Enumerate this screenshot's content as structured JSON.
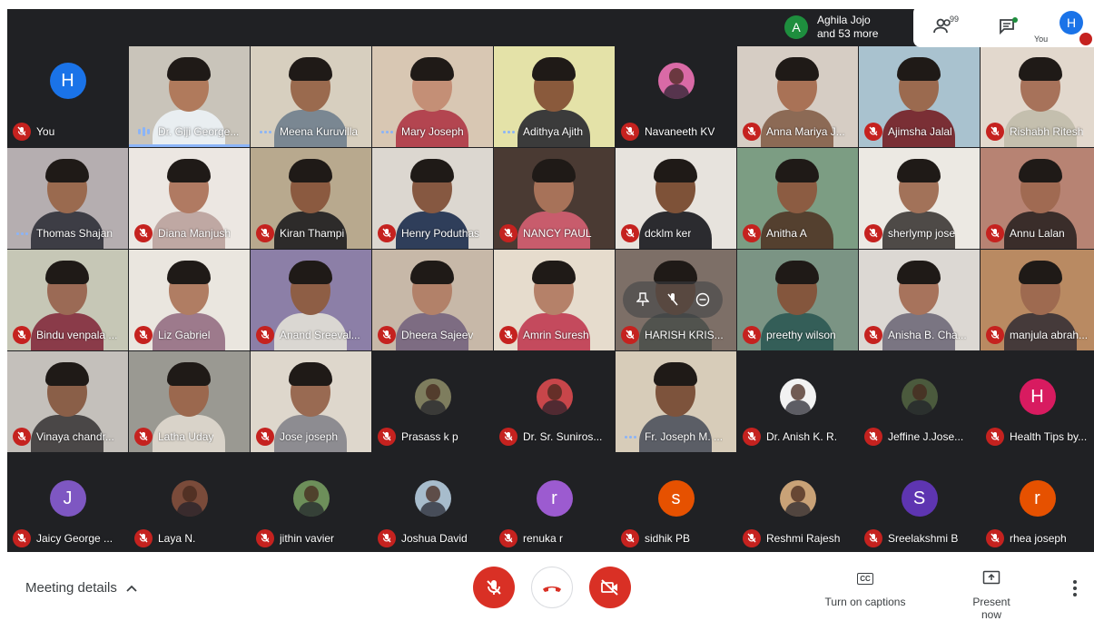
{
  "participants_chip": {
    "initial": "A",
    "line1": "Aghila Jojo",
    "line2": "and 53 more"
  },
  "top_bar": {
    "people_count": "99",
    "self_initial": "H",
    "self_label": "You"
  },
  "tiles": [
    {
      "name": "You",
      "state": "muted",
      "kind": "avatar",
      "initial": "H",
      "color": "#1a73e8"
    },
    {
      "name": "Dr. Giji George...",
      "state": "speaking",
      "kind": "video",
      "bg": "#c9c4ba",
      "skin": "#b07a5c",
      "cloth": "#e9eef1"
    },
    {
      "name": "Meena Kuruvilla",
      "state": "dots",
      "kind": "video",
      "bg": "#d7cfbf",
      "skin": "#9a6a4e",
      "cloth": "#7a8792"
    },
    {
      "name": "Mary Joseph",
      "state": "dots",
      "kind": "video",
      "bg": "#d8c7b3",
      "skin": "#c48f76",
      "cloth": "#b34550"
    },
    {
      "name": "Adithya Ajith",
      "state": "dots",
      "kind": "video",
      "bg": "#e4e2a8",
      "skin": "#8a5a3c",
      "cloth": "#3b3b3b"
    },
    {
      "name": "Navaneeth KV",
      "state": "muted",
      "kind": "avatar-photo",
      "color": "#d96aa6"
    },
    {
      "name": "Anna Mariya J...",
      "state": "muted",
      "kind": "video",
      "bg": "#d6cdc4",
      "skin": "#a97256",
      "cloth": "#8c6a55"
    },
    {
      "name": "Ajimsha Jalal",
      "state": "muted",
      "kind": "video",
      "bg": "#a9c2cf",
      "skin": "#9b6a4f",
      "cloth": "#7a2f35"
    },
    {
      "name": "Rishabh Ritesh",
      "state": "muted",
      "kind": "video",
      "bg": "#e2d8cd",
      "skin": "#a7725a",
      "cloth": "#c4bfae"
    },
    {
      "name": "Thomas Shajan",
      "state": "dots",
      "kind": "video",
      "bg": "#b5aeb0",
      "skin": "#9a6a4f",
      "cloth": "#3d3d45"
    },
    {
      "name": "Diana Manjush",
      "state": "muted",
      "kind": "video",
      "bg": "#ece7e2",
      "skin": "#b07a62",
      "cloth": "#bfa8a3"
    },
    {
      "name": "Kiran Thampi",
      "state": "muted",
      "kind": "video",
      "bg": "#b8a98e",
      "skin": "#8b5a40",
      "cloth": "#2d2b2a"
    },
    {
      "name": "Henry Poduthas",
      "state": "muted",
      "kind": "video",
      "bg": "#dcd7d0",
      "skin": "#865841",
      "cloth": "#2f3e5a"
    },
    {
      "name": "NANCY PAUL",
      "state": "muted",
      "kind": "video",
      "bg": "#4a3a33",
      "skin": "#a77259",
      "cloth": "#c85c6c"
    },
    {
      "name": "dcklm ker",
      "state": "muted",
      "kind": "video",
      "bg": "#e7e3dd",
      "skin": "#7e5238",
      "cloth": "#2b2b2f"
    },
    {
      "name": "Anitha A",
      "state": "muted",
      "kind": "video",
      "bg": "#7c9d83",
      "skin": "#8c5c42",
      "cloth": "#54402f"
    },
    {
      "name": "sherlymp jose",
      "state": "muted",
      "kind": "video",
      "bg": "#ece9e3",
      "skin": "#a27259",
      "cloth": "#4e4a47"
    },
    {
      "name": "Annu Lalan",
      "state": "muted",
      "kind": "video",
      "bg": "#b78373",
      "skin": "#a06a52",
      "cloth": "#3a2d2a"
    },
    {
      "name": "Bindu venpala ...",
      "state": "muted",
      "kind": "video",
      "bg": "#c6c7b6",
      "skin": "#9b6a55",
      "cloth": "#8a3b49"
    },
    {
      "name": "Liz Gabriel",
      "state": "muted",
      "kind": "video",
      "bg": "#eae6df",
      "skin": "#b07d63",
      "cloth": "#9d7a8c"
    },
    {
      "name": "Anand Sreeval...",
      "state": "muted",
      "kind": "video",
      "bg": "#8c7fa7",
      "skin": "#8e5e45",
      "cloth": "#dad7d2"
    },
    {
      "name": "Dheera Sajeev",
      "state": "muted",
      "kind": "video",
      "bg": "#c7b8a8",
      "skin": "#b28169",
      "cloth": "#7d6c82"
    },
    {
      "name": "Amrin Suresh",
      "state": "muted",
      "kind": "video",
      "bg": "#e6dccd",
      "skin": "#b58169",
      "cloth": "#c44a5d"
    },
    {
      "name": "HARISH KRIS...",
      "state": "muted",
      "kind": "video",
      "bg": "#7d6f67",
      "skin": "#7a523d",
      "cloth": "#51534e"
    },
    {
      "name": "preethy wilson",
      "state": "muted",
      "kind": "video",
      "bg": "#7b9484",
      "skin": "#84563d",
      "cloth": "#345e58"
    },
    {
      "name": "Anisha B. Cha...",
      "state": "muted",
      "kind": "video",
      "bg": "#dcd8d3",
      "skin": "#a7735c",
      "cloth": "#7a7582"
    },
    {
      "name": "manjula abrah...",
      "state": "muted",
      "kind": "video",
      "bg": "#b98a62",
      "skin": "#9e6a50",
      "cloth": "#453a3a"
    },
    {
      "name": "Vinaya chandr...",
      "state": "muted",
      "kind": "video",
      "bg": "#c4c0bb",
      "skin": "#8a5f48",
      "cloth": "#4a4747"
    },
    {
      "name": "Latha Uday",
      "state": "muted",
      "kind": "video",
      "bg": "#9a9992",
      "skin": "#9b684e",
      "cloth": "#d9d3c9"
    },
    {
      "name": "Jose joseph",
      "state": "muted",
      "kind": "video",
      "bg": "#ded7cc",
      "skin": "#996a52",
      "cloth": "#8d8c91"
    },
    {
      "name": "Prasass k p",
      "state": "muted",
      "kind": "avatar-photo",
      "color": "#7e7d5e"
    },
    {
      "name": "Dr. Sr. Suniros...",
      "state": "muted",
      "kind": "avatar-photo",
      "color": "#c8464a"
    },
    {
      "name": "Fr. Joseph M. ...",
      "state": "dots",
      "kind": "video",
      "bg": "#d7ccb9",
      "skin": "#7d533c",
      "cloth": "#5b5e66"
    },
    {
      "name": "Dr. Anish K. R.",
      "state": "muted",
      "kind": "avatar-photo",
      "color": "#f2f2f2"
    },
    {
      "name": "Jeffine J.Jose...",
      "state": "muted",
      "kind": "avatar-photo",
      "color": "#4b5a3d"
    },
    {
      "name": "Health Tips by...",
      "state": "muted",
      "kind": "avatar",
      "initial": "H",
      "color": "#d81b60"
    },
    {
      "name": "Jaicy George ...",
      "state": "muted",
      "kind": "avatar",
      "initial": "J",
      "color": "#7e57c2"
    },
    {
      "name": "Laya N.",
      "state": "muted",
      "kind": "avatar-photo",
      "color": "#7a4b3a"
    },
    {
      "name": "jithin vavier",
      "state": "muted",
      "kind": "avatar-photo",
      "color": "#6d8f5a"
    },
    {
      "name": "Joshua David",
      "state": "muted",
      "kind": "avatar-photo",
      "color": "#a7bccc"
    },
    {
      "name": "renuka r",
      "state": "muted",
      "kind": "avatar",
      "initial": "r",
      "color": "#9c5bd0"
    },
    {
      "name": "sidhik PB",
      "state": "muted",
      "kind": "avatar",
      "initial": "s",
      "color": "#e65100"
    },
    {
      "name": "Reshmi Rajesh",
      "state": "muted",
      "kind": "avatar-photo",
      "color": "#c9a277"
    },
    {
      "name": "Sreelakshmi B",
      "state": "muted",
      "kind": "avatar",
      "initial": "S",
      "color": "#5e35b1"
    },
    {
      "name": "rhea joseph",
      "state": "muted",
      "kind": "avatar",
      "initial": "r",
      "color": "#e65100"
    }
  ],
  "bottom_bar": {
    "meeting_details": "Meeting details",
    "captions_label": "Turn on captions",
    "captions_icon": "CC",
    "present_label": "Present now"
  },
  "colors": {
    "danger": "#d93025",
    "meet_bg": "#202124",
    "accent": "#8ab4f8"
  }
}
